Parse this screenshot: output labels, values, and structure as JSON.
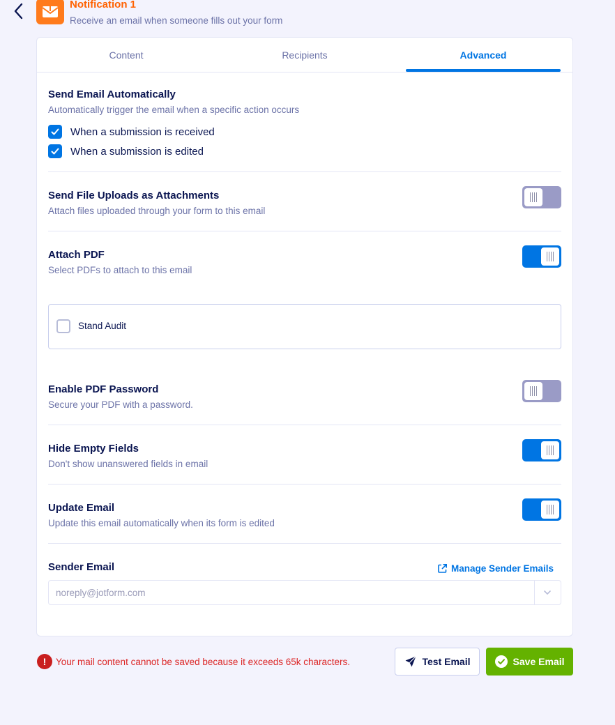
{
  "header": {
    "title": "Notification 1",
    "subtitle": "Receive an email when someone fills out your form"
  },
  "tabs": [
    {
      "label": "Content"
    },
    {
      "label": "Recipients"
    },
    {
      "label": "Advanced"
    }
  ],
  "active_tab": "Advanced",
  "send_auto": {
    "title": "Send Email Automatically",
    "desc": "Automatically trigger the email when a specific action occurs",
    "options": [
      {
        "label": "When a submission is received",
        "checked": true
      },
      {
        "label": "When a submission is edited",
        "checked": true
      }
    ]
  },
  "file_uploads": {
    "title": "Send File Uploads as Attachments",
    "desc": "Attach files uploaded through your form to this email",
    "enabled": false
  },
  "attach_pdf": {
    "title": "Attach PDF",
    "desc": "Select PDFs to attach to this email",
    "enabled": true,
    "pdfs": [
      {
        "label": "Stand Audit",
        "checked": false
      }
    ]
  },
  "pdf_password": {
    "title": "Enable PDF Password",
    "desc": "Secure your PDF with a password.",
    "enabled": false
  },
  "hide_empty": {
    "title": "Hide Empty Fields",
    "desc": "Don't show unanswered fields in email",
    "enabled": true
  },
  "update_email": {
    "title": "Update Email",
    "desc": "Update this email automatically when its form is edited",
    "enabled": true
  },
  "sender": {
    "title": "Sender Email",
    "manage_label": "Manage Sender Emails",
    "value": "noreply@jotform.com"
  },
  "footer": {
    "error": "Your mail content cannot be saved because it exceeds 65k characters.",
    "test_label": "Test Email",
    "save_label": "Save Email"
  },
  "colors": {
    "accent": "#0075e3",
    "brand_orange": "#ff6100",
    "save_green": "#64b200",
    "error_red": "#dc2626",
    "toggle_off": "#9a9bc6"
  }
}
